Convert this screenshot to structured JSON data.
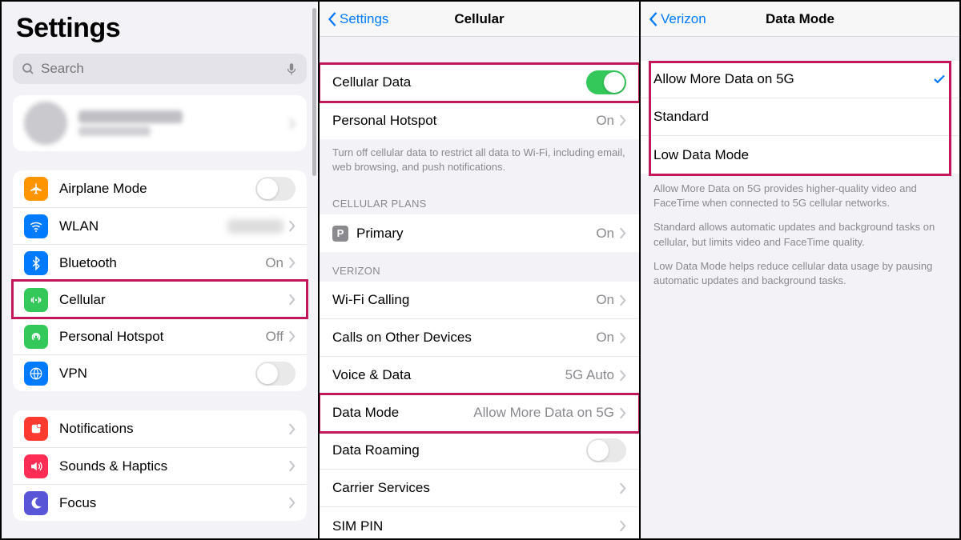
{
  "pane1": {
    "title": "Settings",
    "search_placeholder": "Search",
    "group1": [
      {
        "key": "airplane",
        "label": "Airplane Mode",
        "icon_bg": "#ff9500",
        "value": "",
        "type": "toggle",
        "toggle_on": false
      },
      {
        "key": "wlan",
        "label": "WLAN",
        "icon_bg": "#007aff",
        "value": "",
        "type": "disclosure_blur"
      },
      {
        "key": "bluetooth",
        "label": "Bluetooth",
        "icon_bg": "#007aff",
        "value": "On",
        "type": "disclosure"
      },
      {
        "key": "cellular",
        "label": "Cellular",
        "icon_bg": "#34c759",
        "value": "",
        "type": "disclosure",
        "highlight": true
      },
      {
        "key": "hotspot",
        "label": "Personal Hotspot",
        "icon_bg": "#34c759",
        "value": "Off",
        "type": "disclosure"
      },
      {
        "key": "vpn",
        "label": "VPN",
        "icon_bg": "#007aff",
        "value": "",
        "type": "toggle",
        "toggle_on": false
      }
    ],
    "group2": [
      {
        "key": "notifications",
        "label": "Notifications",
        "icon_bg": "#ff3b30",
        "type": "disclosure"
      },
      {
        "key": "sounds",
        "label": "Sounds & Haptics",
        "icon_bg": "#ff2d55",
        "type": "disclosure"
      },
      {
        "key": "focus",
        "label": "Focus",
        "icon_bg": "#5856d6",
        "type": "disclosure"
      }
    ]
  },
  "pane2": {
    "back": "Settings",
    "title": "Cellular",
    "rows1": [
      {
        "key": "cellular_data",
        "label": "Cellular Data",
        "type": "toggle",
        "toggle_on": true,
        "highlight": true
      },
      {
        "key": "personal_hotspot",
        "label": "Personal Hotspot",
        "value": "On",
        "type": "disclosure"
      }
    ],
    "note1": "Turn off cellular data to restrict all data to Wi-Fi, including email, web browsing, and push notifications.",
    "header_plans": "CELLULAR PLANS",
    "rows_plans": [
      {
        "key": "primary",
        "label": "Primary",
        "value": "On",
        "type": "disclosure",
        "picon": "P"
      }
    ],
    "header_verizon": "VERIZON",
    "rows_verizon": [
      {
        "key": "wifi_calling",
        "label": "Wi-Fi Calling",
        "value": "On",
        "type": "disclosure"
      },
      {
        "key": "calls_other",
        "label": "Calls on Other Devices",
        "value": "On",
        "type": "disclosure"
      },
      {
        "key": "voice_data",
        "label": "Voice & Data",
        "value": "5G Auto",
        "type": "disclosure"
      },
      {
        "key": "data_mode",
        "label": "Data Mode",
        "value": "Allow More Data on 5G",
        "type": "disclosure",
        "highlight": true
      },
      {
        "key": "data_roaming",
        "label": "Data Roaming",
        "type": "toggle",
        "toggle_on": false
      },
      {
        "key": "carrier_services",
        "label": "Carrier Services",
        "type": "disclosure"
      },
      {
        "key": "sim_pin",
        "label": "SIM PIN",
        "type": "disclosure"
      }
    ]
  },
  "pane3": {
    "back": "Verizon",
    "title": "Data Mode",
    "options": [
      {
        "key": "allow_more",
        "label": "Allow More Data on 5G",
        "selected": true
      },
      {
        "key": "standard",
        "label": "Standard",
        "selected": false
      },
      {
        "key": "low_data",
        "label": "Low Data Mode",
        "selected": false
      }
    ],
    "desc1": "Allow More Data on 5G provides higher-quality video and FaceTime when connected to 5G cellular networks.",
    "desc2": "Standard allows automatic updates and background tasks on cellular, but limits video and FaceTime quality.",
    "desc3": "Low Data Mode helps reduce cellular data usage by pausing automatic updates and background tasks."
  }
}
